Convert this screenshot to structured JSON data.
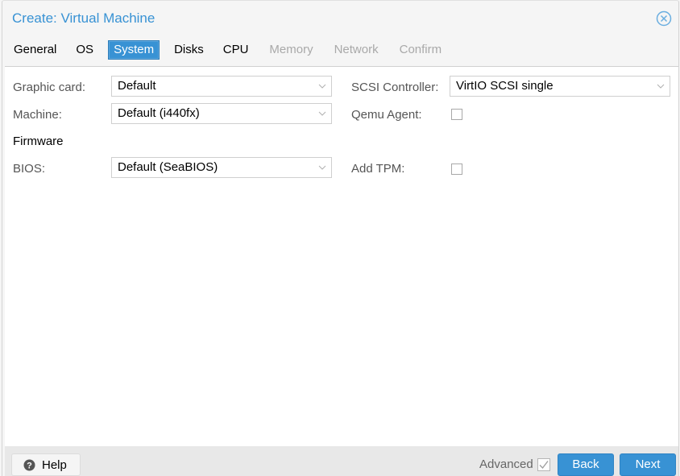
{
  "window": {
    "title": "Create: Virtual Machine",
    "close_icon": "close-circle-icon"
  },
  "tabs": [
    {
      "label": "General",
      "state": "normal"
    },
    {
      "label": "OS",
      "state": "normal"
    },
    {
      "label": "System",
      "state": "active"
    },
    {
      "label": "Disks",
      "state": "normal"
    },
    {
      "label": "CPU",
      "state": "normal"
    },
    {
      "label": "Memory",
      "state": "disabled"
    },
    {
      "label": "Network",
      "state": "disabled"
    },
    {
      "label": "Confirm",
      "state": "disabled"
    }
  ],
  "form": {
    "graphic_card": {
      "label": "Graphic card:",
      "value": "Default"
    },
    "machine": {
      "label": "Machine:",
      "value": "Default (i440fx)"
    },
    "firmware_section": "Firmware",
    "bios": {
      "label": "BIOS:",
      "value": "Default (SeaBIOS)"
    },
    "scsi_controller": {
      "label": "SCSI Controller:",
      "value": "VirtIO SCSI single"
    },
    "qemu_agent": {
      "label": "Qemu Agent:",
      "checked": false
    },
    "add_tpm": {
      "label": "Add TPM:",
      "checked": false
    }
  },
  "footer": {
    "help_label": "Help",
    "advanced_label": "Advanced",
    "advanced_checked": true,
    "back_label": "Back",
    "next_label": "Next"
  },
  "colors": {
    "accent": "#3892d4",
    "disabled_text": "#a9a9a9",
    "label_text": "#555555"
  }
}
